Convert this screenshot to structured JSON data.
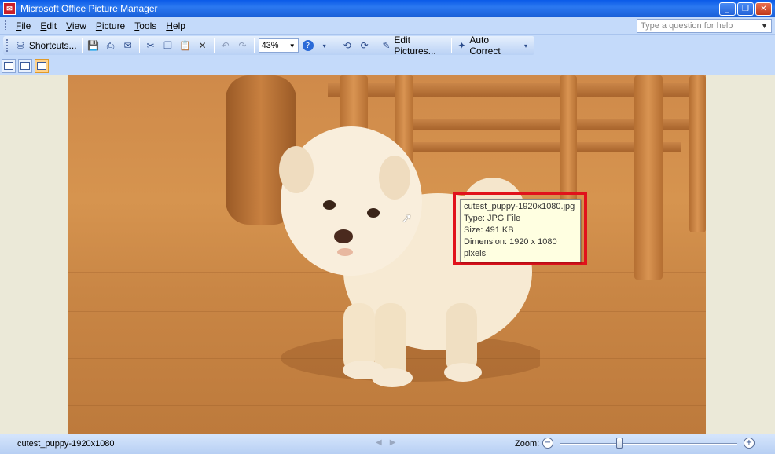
{
  "window": {
    "title": "Microsoft Office Picture Manager",
    "minimize": "_",
    "maximize": "❐",
    "close": "✕"
  },
  "menu": {
    "items": [
      {
        "label": "File",
        "u": "F",
        "rest": "ile"
      },
      {
        "label": "Edit",
        "u": "E",
        "rest": "dit"
      },
      {
        "label": "View",
        "u": "V",
        "rest": "iew"
      },
      {
        "label": "Picture",
        "u": "P",
        "rest": "icture"
      },
      {
        "label": "Tools",
        "u": "T",
        "rest": "ools"
      },
      {
        "label": "Help",
        "u": "H",
        "rest": "elp"
      }
    ],
    "help_placeholder": "Type a question for help"
  },
  "toolbar": {
    "shortcuts_label": "Shortcuts...",
    "zoom_value": "43%",
    "edit_pictures_label": "Edit Pictures...",
    "auto_correct_label": "Auto Correct"
  },
  "tooltip": {
    "line1": "cutest_puppy-1920x1080.jpg",
    "line2": "Type: JPG File",
    "line3": "Size: 491 KB",
    "line4": "Dimension: 1920 x 1080",
    "line5": "pixels"
  },
  "status": {
    "filename": "cutest_puppy-1920x1080",
    "zoom_label": "Zoom:",
    "zoom_level": 0.33
  },
  "colors": {
    "highlight": "#e1121b"
  }
}
